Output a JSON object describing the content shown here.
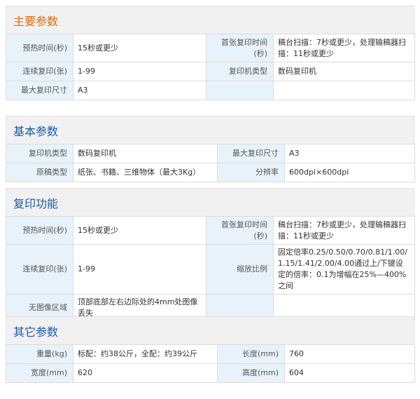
{
  "sections": [
    {
      "title": "主要参数",
      "rows": [
        [
          "预热时间(秒)",
          "15秒或更少",
          "首张复印时间(秒)",
          "稿台扫描：7秒或更少，处理输稿器扫描：11秒或更少"
        ],
        [
          "连续复印(张)",
          "1-99",
          "复印机类型",
          "数码复印机"
        ],
        [
          "最大复印尺寸",
          "A3",
          "",
          ""
        ]
      ]
    },
    {
      "title": "基本参数",
      "rows": [
        [
          "复印机类型",
          "数码复印机",
          "最大复印尺寸",
          "A3"
        ],
        [
          "原稿类型",
          "纸张、书籍、三维物体（最大3Kg）",
          "分辨率",
          "600dpi×600dpi"
        ]
      ]
    },
    {
      "title": "复印功能",
      "rows": [
        [
          "预热时间(秒)",
          "15秒或更少",
          "首张复印时间(秒)",
          "稿台扫描：7秒或更少，处理输稿器扫描：11秒或更少"
        ],
        [
          "连续复印(张)",
          "1-99",
          "缩放比例",
          "固定倍率0.25/0.50/0.70/0.81/1.00/1.15/1.41/2.00/4.00通过上/下键设定的倍率：0.1为增幅在25%—400%之间"
        ],
        [
          "无图像区域",
          "顶部底部左右边际处的4mm处图像丢失",
          "",
          ""
        ]
      ]
    },
    {
      "title": "其它参数",
      "rows": [
        [
          "重量(kg)",
          "标配：约38公斤，全配：约39公斤",
          "长度(mm)",
          "760"
        ],
        [
          "宽度(mm)",
          "620",
          "高度(mm)",
          "604"
        ]
      ]
    }
  ]
}
